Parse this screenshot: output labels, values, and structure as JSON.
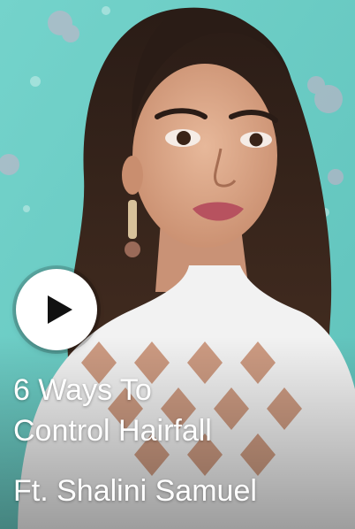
{
  "video_card": {
    "title_lines": [
      "6 Ways To",
      "Control Hairfall"
    ],
    "subtitle": "Ft. Shalini Samuel",
    "play_icon": "play-icon"
  },
  "colors": {
    "background_teal": "#69cbc3",
    "overlay_text": "#ffffff",
    "play_button_bg": "#ffffff",
    "play_icon": "#111111"
  }
}
